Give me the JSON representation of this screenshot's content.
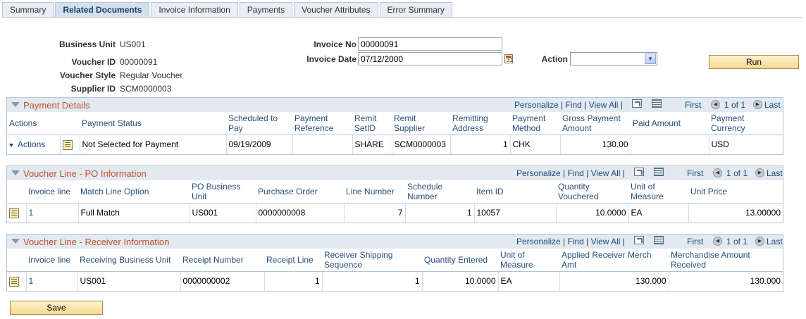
{
  "tabs": [
    "Summary",
    "Related Documents",
    "Invoice Information",
    "Payments",
    "Voucher Attributes",
    "Error Summary"
  ],
  "header": {
    "business_unit_label": "Business Unit",
    "business_unit": "US001",
    "voucher_id_label": "Voucher ID",
    "voucher_id": "00000091",
    "voucher_style_label": "Voucher Style",
    "voucher_style": "Regular Voucher",
    "supplier_id_label": "Supplier ID",
    "supplier_id": "SCM0000003",
    "invoice_no_label": "Invoice No",
    "invoice_no": "00000091",
    "invoice_date_label": "Invoice Date",
    "invoice_date": "07/12/2000",
    "action_label": "Action",
    "action_value": "",
    "run_label": "Run"
  },
  "nav": {
    "personalize": "Personalize",
    "find": "Find",
    "view_all": "View All",
    "first": "First",
    "paging": "1 of 1",
    "last": "Last"
  },
  "payment_details": {
    "title": "Payment Details",
    "columns": [
      "Actions",
      "",
      "Payment Status",
      "Scheduled to Pay",
      "Payment Reference",
      "Remit SetID",
      "Remit Supplier",
      "Remitting Address",
      "Payment Method",
      "Gross Payment Amount",
      "Paid Amount",
      "Payment Currency"
    ],
    "row": {
      "actions": "Actions",
      "status": "Not Selected for Payment",
      "scheduled": "09/19/2009",
      "reference": "",
      "setid": "SHARE",
      "supplier": "SCM0000003",
      "address": "1",
      "method": "CHK",
      "gross": "130.00",
      "paid": "",
      "currency": "USD"
    }
  },
  "po_info": {
    "title": "Voucher Line - PO Information",
    "columns": [
      "",
      "Invoice line",
      "Match Line Option",
      "PO Business Unit",
      "Purchase Order",
      "Line Number",
      "Schedule Number",
      "Item ID",
      "Quantity Vouchered",
      "Unit of Measure",
      "Unit Price"
    ],
    "row": {
      "invoice_line": "1",
      "match": "Full Match",
      "po_bu": "US001",
      "po": "0000000008",
      "line": "7",
      "schedule": "1",
      "item": "10057",
      "qty": "10.0000",
      "uom": "EA",
      "price": "13.00000"
    }
  },
  "receiver_info": {
    "title": "Voucher Line - Receiver Information",
    "columns": [
      "",
      "Invoice line",
      "Receiving Business Unit",
      "Receipt Number",
      "Receipt Line",
      "Receiver Shipping Sequence",
      "Quantity Entered",
      "Unit of Measure",
      "Applied Receiver Merch Amt",
      "Merchandise Amount Received"
    ],
    "row": {
      "invoice_line": "1",
      "rbu": "US001",
      "receipt": "0000000002",
      "receipt_line": "1",
      "seq": "1",
      "qty": "10.0000",
      "uom": "EA",
      "applied": "130.000",
      "received": "130.000"
    }
  },
  "save_label": "Save"
}
